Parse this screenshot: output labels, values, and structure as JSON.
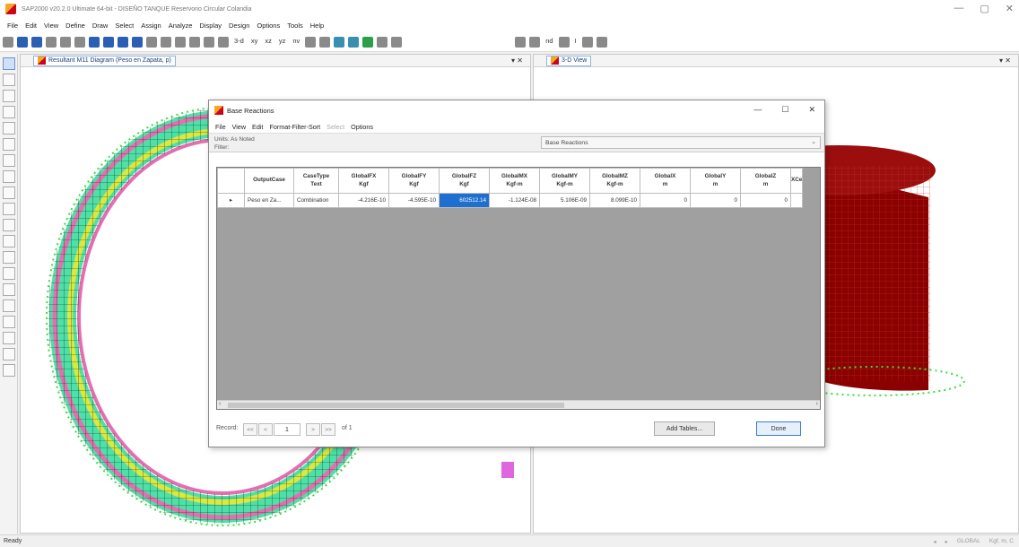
{
  "window": {
    "title": "SAP2000 v20.2.0 Ultimate 64-bit - DISEÑO TANQUE Reservorio Circular Colandia",
    "minimize": "—",
    "maximize": "▢",
    "close": "✕"
  },
  "menu": [
    "File",
    "Edit",
    "View",
    "Define",
    "Draw",
    "Select",
    "Assign",
    "Analyze",
    "Display",
    "Design",
    "Options",
    "Tools",
    "Help"
  ],
  "toolbar": {
    "labels": [
      "3-d",
      "xy",
      "xz",
      "yz",
      "nv"
    ],
    "right_labels": [
      "nd",
      "I"
    ]
  },
  "left_pane": {
    "tab_label": "Resultant M11 Diagram  (Peso en Zapata, p)",
    "close": "▾ ✕"
  },
  "right_pane": {
    "tab_label": "3-D View",
    "close": "▾ ✕"
  },
  "dialog": {
    "title": "Base Reactions",
    "minimize": "—",
    "maximize": "☐",
    "close": "✕",
    "menu": [
      "File",
      "View",
      "Edit",
      "Format-Filter-Sort",
      "Select",
      "Options"
    ],
    "units": "Units: As Noted",
    "filter": "Filter:",
    "table_select": "Base Reactions",
    "columns": [
      {
        "name": "OutputCase",
        "unit": ""
      },
      {
        "name": "CaseType",
        "unit": "Text"
      },
      {
        "name": "GlobalFX",
        "unit": "Kgf"
      },
      {
        "name": "GlobalFY",
        "unit": "Kgf"
      },
      {
        "name": "GlobalFZ",
        "unit": "Kgf"
      },
      {
        "name": "GlobalMX",
        "unit": "Kgf-m"
      },
      {
        "name": "GlobalMY",
        "unit": "Kgf-m"
      },
      {
        "name": "GlobalMZ",
        "unit": "Kgf-m"
      },
      {
        "name": "GlobalX",
        "unit": "m"
      },
      {
        "name": "GlobalY",
        "unit": "m"
      },
      {
        "name": "GlobalZ",
        "unit": "m"
      },
      {
        "name": "XCe",
        "unit": ""
      }
    ],
    "rows": [
      {
        "marker": "▸",
        "OutputCase": "Peso en Za...",
        "CaseType": "Combination",
        "GlobalFX": "-4.216E-10",
        "GlobalFY": "-4.595E-10",
        "GlobalFZ": "602512.14",
        "GlobalMX": "-1.124E-08",
        "GlobalMY": "5.106E-09",
        "GlobalMZ": "8.099E-10",
        "GlobalX": "0",
        "GlobalY": "0",
        "GlobalZ": "0",
        "XCe": ""
      }
    ],
    "record_label": "Record:",
    "nav": [
      "<<",
      "<",
      ">",
      ">>"
    ],
    "record_value": "1",
    "of_label": "of 1",
    "add_tables": "Add Tables...",
    "done": "Done"
  },
  "status": {
    "ready": "Ready",
    "coord_system": "GLOBAL",
    "units": "Kgf, m, C"
  },
  "colors": {
    "highlight": "#1f6fd0",
    "ring_green": "#29d36b",
    "ring_yellow": "#d8e63a",
    "ring_pink": "#e46fb0",
    "tank_red": "#8b0000"
  }
}
